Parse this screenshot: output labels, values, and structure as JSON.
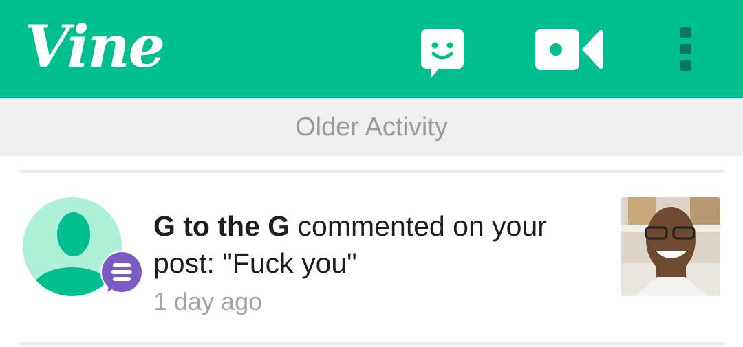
{
  "appbar": {
    "logo_text": "Vine",
    "colors": {
      "primary": "#00bf8f",
      "icon": "#ffffff",
      "menu_dots": "#087a5e"
    },
    "icons": [
      "messages-icon",
      "camera-icon",
      "overflow-menu-icon"
    ]
  },
  "older_activity": {
    "label": "Older Activity"
  },
  "activity": {
    "user": "G to the G",
    "action": " commented on your post: \"Fuck you\"",
    "time": "1 day ago",
    "badge_color": "#7c5cc4",
    "avatar_color": "#aef0d7"
  }
}
